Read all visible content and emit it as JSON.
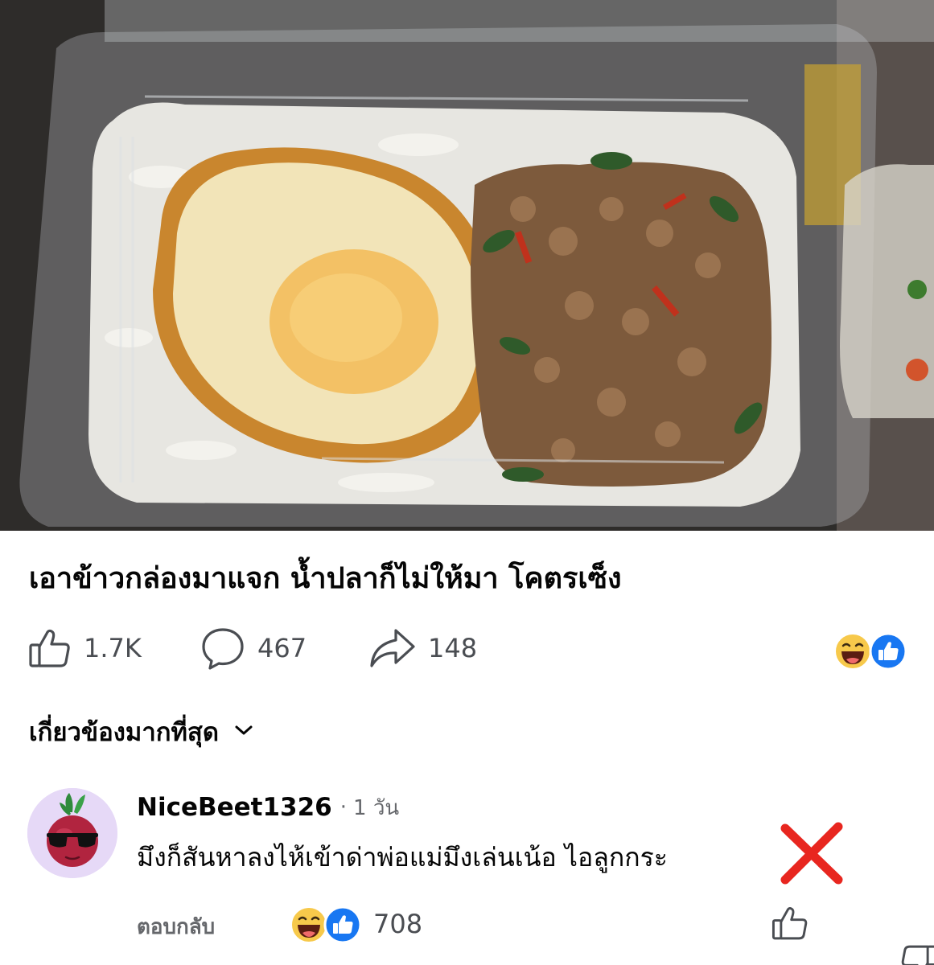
{
  "post": {
    "title": "เอาข้าวกล่องมาแจก น้ำปลาก็ไม่ให้มา โคตรเซ็ง",
    "photo_icon": "food-photo"
  },
  "actions": {
    "like_count": "1.7K",
    "comment_count": "467",
    "share_count": "148",
    "reaction_icons": [
      "haha-emoji",
      "like-badge"
    ]
  },
  "sort": {
    "label": "เกี่ยวข้องมากที่สุด"
  },
  "comment": {
    "username": "NiceBeet1326",
    "separator": "·",
    "time": "1 วัน",
    "text": "มึงก็สันหาลงไห้เข้าด่าพ่อแม่มึงเล่นเน้อ ไอลูกกระ",
    "reply_label": "ตอบกลับ",
    "reaction_count": "708",
    "colors": {
      "x_mark": "#e8261f",
      "accent": "#1877f2"
    }
  }
}
